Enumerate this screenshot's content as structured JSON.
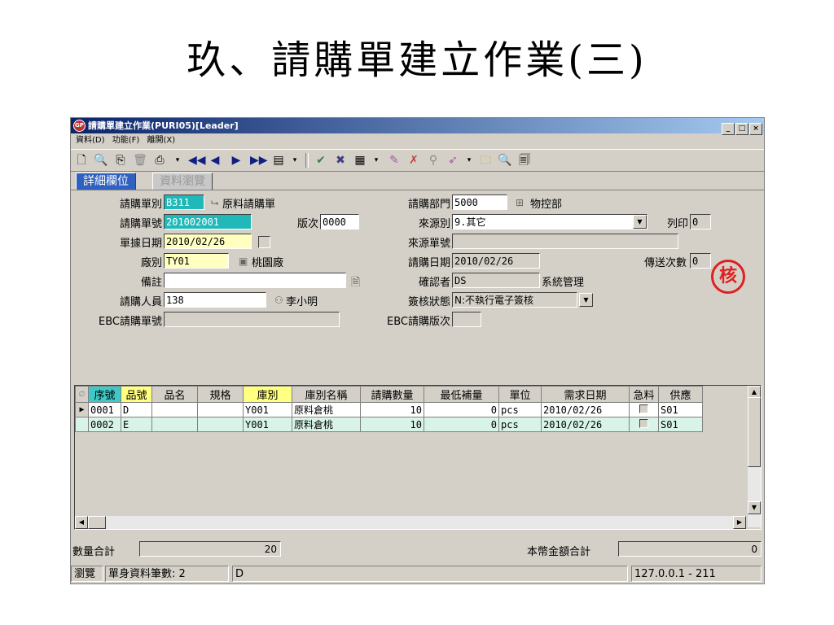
{
  "slide": {
    "title": "玖、請購單建立作業(三)"
  },
  "window": {
    "title": "請購單建立作業(PURI05)[Leader]",
    "icon_label": "GP",
    "controls": {
      "minimize": "_",
      "maximize": "□",
      "close": "×"
    }
  },
  "menu": {
    "items": [
      "資料(D)",
      "功能(F)",
      "離開(X)"
    ]
  },
  "toolbar": {
    "icons": [
      "new-icon",
      "preview-icon",
      "copy-icon",
      "delete-icon",
      "print-icon",
      "first-record-icon",
      "prev-record-icon",
      "next-record-icon",
      "last-record-icon",
      "record-menu-icon",
      "confirm-icon",
      "cancel-icon",
      "calc-icon",
      "approve-icon",
      "reject-icon",
      "filter-icon",
      "send-icon",
      "folder-icon",
      "search-icon",
      "document-icon"
    ]
  },
  "tabs": {
    "detail": "詳細欄位",
    "browse": "資料瀏覽"
  },
  "form": {
    "req_type_label": "請購單別",
    "req_type_value": "B311",
    "req_type_name": "原料請購單",
    "req_no_label": "請購單號",
    "req_no_value": "201002001",
    "version_label": "版次",
    "version_value": "0000",
    "doc_date_label": "單據日期",
    "doc_date_value": "2010/02/26",
    "plant_label": "廠別",
    "plant_value": "TY01",
    "plant_name": "桃園廠",
    "note_label": "備註",
    "note_value": "",
    "requester_label": "請購人員",
    "requester_value": "138",
    "requester_name": "李小明",
    "ebc_no_label": "EBC請購單號",
    "ebc_no_value": "",
    "dept_label": "請購部門",
    "dept_value": "5000",
    "dept_name": "物控部",
    "source_label": "來源別",
    "source_value": "9.其它",
    "print_label": "列印",
    "print_value": "0",
    "source_no_label": "來源單號",
    "source_no_value": "",
    "req_date_label": "請購日期",
    "req_date_value": "2010/02/26",
    "send_count_label": "傳送次數",
    "send_count_value": "0",
    "confirmer_label": "確認者",
    "confirmer_value": "DS",
    "confirmer_name": "系統管理",
    "sign_status_label": "簽核狀態",
    "sign_status_value": "N:不執行電子簽核",
    "ebc_ver_label": "EBC請購版次",
    "ebc_ver_value": "",
    "stamp": "核"
  },
  "grid": {
    "headers": [
      "序號",
      "品號",
      "品名",
      "規格",
      "庫別",
      "庫別名稱",
      "請購數量",
      "最低補量",
      "單位",
      "需求日期",
      "急料",
      "供應"
    ],
    "rows": [
      [
        "0001",
        "D",
        "",
        "",
        "Y001",
        "原料倉桃",
        "10",
        "0",
        "pcs",
        "2010/02/26",
        "",
        "S01"
      ],
      [
        "0002",
        "E",
        "",
        "",
        "Y001",
        "原料倉桃",
        "10",
        "0",
        "pcs",
        "2010/02/26",
        "",
        "S01"
      ]
    ]
  },
  "totals": {
    "qty_label": "數量合計",
    "qty_value": "20",
    "amount_label": "本幣金額合計",
    "amount_value": "0"
  },
  "status": {
    "mode": "瀏覽",
    "records": "單身資料筆數: 2",
    "current": "D",
    "server": "127.0.0.1 - 211"
  }
}
